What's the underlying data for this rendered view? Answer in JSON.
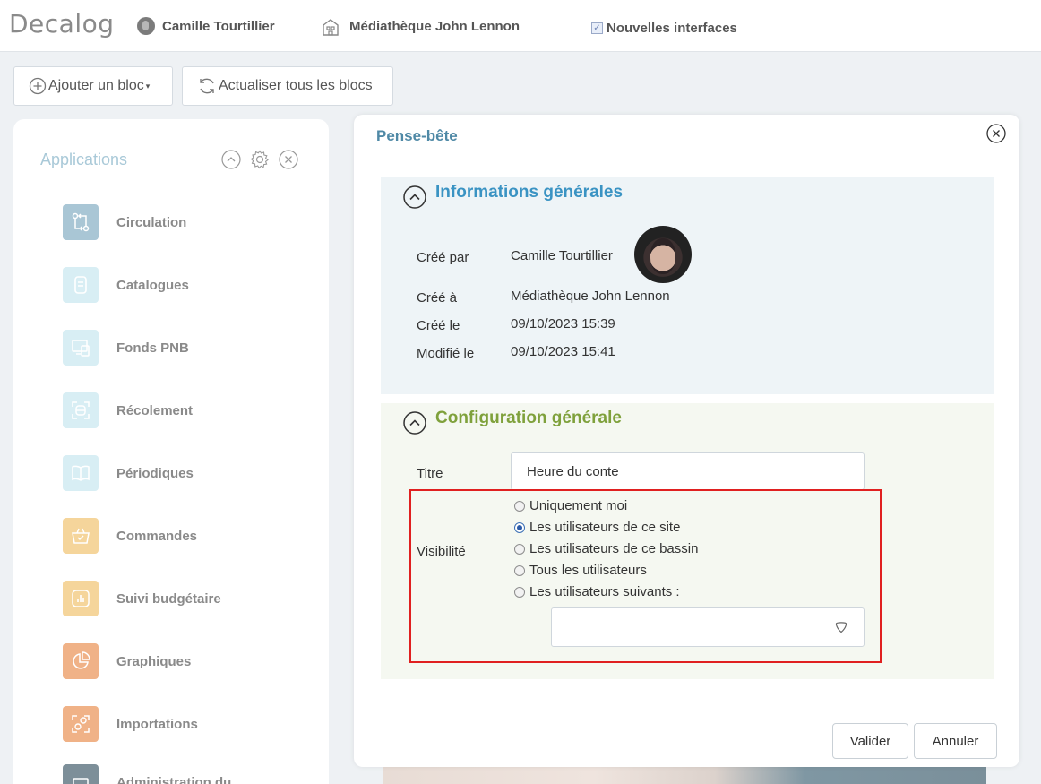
{
  "header": {
    "logo": "Decalog",
    "user_name": "Camille Tourtillier",
    "site_name": "Médiathèque John Lennon",
    "new_interfaces_label": "Nouvelles interfaces",
    "new_interfaces_checked": true
  },
  "toolbar": {
    "add_block_label": "Ajouter un bloc",
    "refresh_all_label": "Actualiser tous les blocs"
  },
  "sidebar": {
    "title": "Applications",
    "items": [
      {
        "label": "Circulation",
        "color": "#a9c6d5"
      },
      {
        "label": "Catalogues",
        "color": "#d8eef4"
      },
      {
        "label": "Fonds PNB",
        "color": "#d8eef4"
      },
      {
        "label": "Récolement",
        "color": "#d8eef4"
      },
      {
        "label": "Périodiques",
        "color": "#d8eef4"
      },
      {
        "label": "Commandes",
        "color": "#f5d59b"
      },
      {
        "label": "Suivi budgétaire",
        "color": "#f5d59b"
      },
      {
        "label": "Graphiques",
        "color": "#f0b287"
      },
      {
        "label": "Importations",
        "color": "#f0b287"
      },
      {
        "label": "Administration du",
        "color": "#7d8f99"
      }
    ]
  },
  "modal": {
    "title": "Pense-bête",
    "info_section": {
      "title": "Informations générales",
      "created_by_label": "Créé par",
      "created_by_value": "Camille Tourtillier",
      "created_at_label": "Créé à",
      "created_at_value": "Médiathèque John Lennon",
      "created_on_label": "Créé le",
      "created_on_value": "09/10/2023 15:39",
      "modified_on_label": "Modifié le",
      "modified_on_value": "09/10/2023 15:41"
    },
    "config_section": {
      "title": "Configuration générale",
      "title_label": "Titre",
      "title_value": "Heure du conte",
      "visibility_label": "Visibilité",
      "visibility_options": [
        {
          "label": "Uniquement moi",
          "selected": false
        },
        {
          "label": "Les utilisateurs de ce site",
          "selected": true
        },
        {
          "label": "Les utilisateurs de ce bassin",
          "selected": false
        },
        {
          "label": "Tous les utilisateurs",
          "selected": false
        },
        {
          "label": "Les utilisateurs suivants :",
          "selected": false
        }
      ]
    },
    "validate_label": "Valider",
    "cancel_label": "Annuler"
  },
  "colors": {
    "info_title": "#3a93c3",
    "config_title": "#7fa13c",
    "highlight_border": "#e02020",
    "modal_title": "#4f89a6"
  }
}
